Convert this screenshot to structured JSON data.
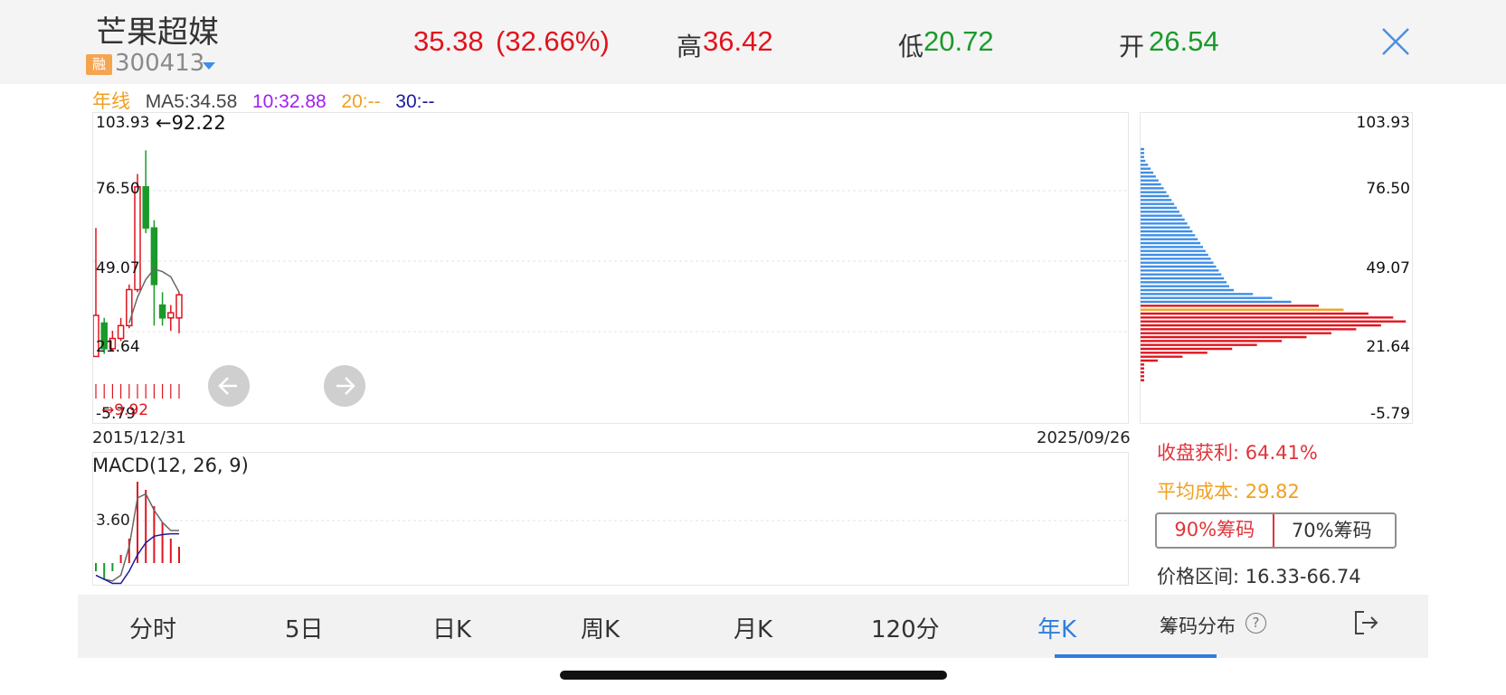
{
  "header": {
    "stock_name": "芒果超媒",
    "badge": "融",
    "stock_code": "300413",
    "price": "35.38",
    "change_pct": "(32.66%)",
    "high_label": "高",
    "high": "36.42",
    "low_label": "低",
    "low": "20.72",
    "open_label": "开",
    "open": "26.54"
  },
  "ma": {
    "period": "年线",
    "ma5": "MA5:34.58",
    "ma10": "10:32.88",
    "ma20": "20:--",
    "ma30": "30:--"
  },
  "chart": {
    "y_labels": [
      "103.93",
      "76.50",
      "49.07",
      "21.64",
      "-5.79"
    ],
    "max_note": "←92.22",
    "min_note": "→9.92",
    "date_start": "2015/12/31",
    "date_end": "2025/09/26"
  },
  "macd": {
    "label": "MACD(12, 26, 9)",
    "value": "3.60"
  },
  "chip": {
    "y_labels": [
      "103.93",
      "76.50",
      "49.07",
      "21.64",
      "-5.79"
    ],
    "profit": "收盘获利: 64.41%",
    "avg_cost": "平均成本: 29.82",
    "tab90": "90%筹码",
    "tab70": "70%筹码",
    "price_range": "价格区间: 16.33-66.74"
  },
  "tabs": [
    "分时",
    "5日",
    "日K",
    "周K",
    "月K",
    "120分",
    "年K"
  ],
  "bottom": {
    "chip_dist": "筹码分布",
    "help": "?"
  },
  "colors": {
    "up": "#e0141e",
    "down": "#1a9a2a",
    "accent": "#2e7fe0"
  },
  "chart_data": {
    "type": "candlestick",
    "y_range": [
      -5.79,
      103.93
    ],
    "candles": [
      {
        "open": 12,
        "close": 28,
        "high": 62,
        "low": 12,
        "dir": "up"
      },
      {
        "open": 25,
        "close": 15,
        "high": 27,
        "low": 13,
        "dir": "down"
      },
      {
        "open": 15,
        "close": 19,
        "high": 22,
        "low": 14,
        "dir": "up"
      },
      {
        "open": 19,
        "close": 24,
        "high": 27,
        "low": 18,
        "dir": "up"
      },
      {
        "open": 24,
        "close": 38,
        "high": 40,
        "low": 23,
        "dir": "up"
      },
      {
        "open": 38,
        "close": 78,
        "high": 83,
        "low": 37,
        "dir": "up"
      },
      {
        "open": 78,
        "close": 62,
        "high": 92.22,
        "low": 60,
        "dir": "down"
      },
      {
        "open": 62,
        "close": 40,
        "high": 65,
        "low": 24,
        "dir": "down"
      },
      {
        "open": 32,
        "close": 27,
        "high": 37,
        "low": 24,
        "dir": "down"
      },
      {
        "open": 27,
        "close": 29,
        "high": 32,
        "low": 22,
        "dir": "up"
      },
      {
        "open": 27,
        "close": 36,
        "high": 37,
        "low": 21,
        "dir": "up"
      }
    ],
    "ma5": [
      null,
      null,
      null,
      null,
      25,
      35,
      42,
      46,
      45,
      43,
      37
    ],
    "macd_hist": [
      -1,
      -2,
      -1,
      1,
      3,
      10,
      9,
      7,
      5,
      3,
      2
    ],
    "dif": [
      -1.5,
      -2,
      -2.2,
      -1.5,
      2,
      8,
      8.5,
      6.5,
      5,
      4,
      4
    ],
    "dea": [
      -1.5,
      -2,
      -2.5,
      -2.5,
      -1,
      1,
      2.5,
      3.3,
      3.5,
      3.6,
      3.6
    ]
  }
}
